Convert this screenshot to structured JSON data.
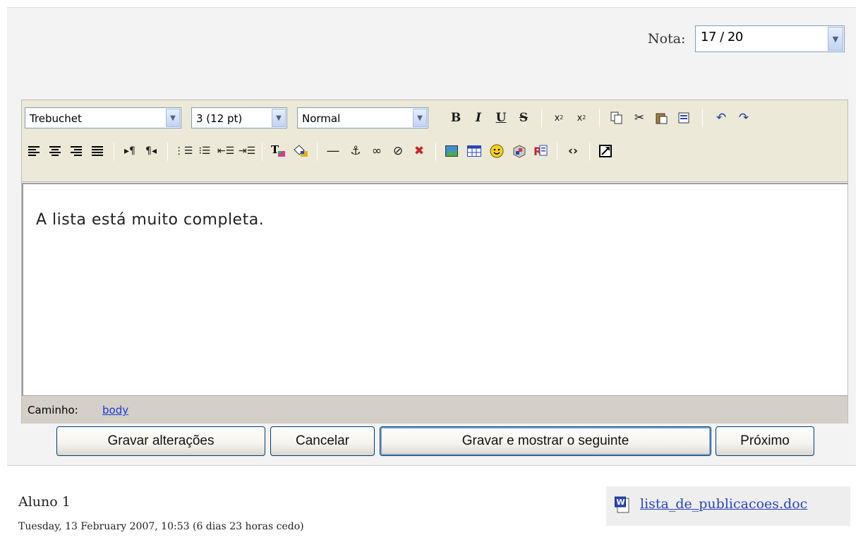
{
  "grade": {
    "label": "Nota:",
    "selected": "17 / 20"
  },
  "editor": {
    "font_family": "Trebuchet",
    "font_size": "3 (12 pt)",
    "paragraph_format": "Normal",
    "content_text": "A lista está muito completa.",
    "statusbar": {
      "path_label": "Caminho:",
      "path_value": "body"
    },
    "toolbar_icons": [
      "bold-icon",
      "italic-icon",
      "underline-icon",
      "strikethrough-icon",
      "subscript-icon",
      "superscript-icon",
      "copy-icon",
      "cut-icon",
      "paste-icon",
      "paste-word-icon",
      "undo-icon",
      "redo-icon",
      "align-left-icon",
      "align-center-icon",
      "align-right-icon",
      "justify-icon",
      "ltr-icon",
      "rtl-icon",
      "ordered-list-icon",
      "unordered-list-icon",
      "outdent-icon",
      "indent-icon",
      "text-color-icon",
      "background-color-icon",
      "horizontal-rule-icon",
      "anchor-icon",
      "link-icon",
      "unlink-icon",
      "no-link-icon",
      "image-icon",
      "table-icon",
      "smiley-icon",
      "special-char-icon",
      "search-replace-icon",
      "html-source-icon",
      "fullscreen-icon"
    ]
  },
  "buttons": {
    "save": "Gravar alterações",
    "cancel": "Cancelar",
    "save_next": "Gravar e mostrar o seguinte",
    "next": "Próximo"
  },
  "submission": {
    "student": "Aluno 1",
    "timestamp": "Tuesday, 13 February 2007, 10:53 (6 dias 23 horas cedo)",
    "file": "lista_de_publicacoes.doc"
  },
  "colors": {
    "link": "#2a45b8",
    "toolbar_bg": "#ece9d8",
    "panel_bg": "#f3f3f3"
  }
}
